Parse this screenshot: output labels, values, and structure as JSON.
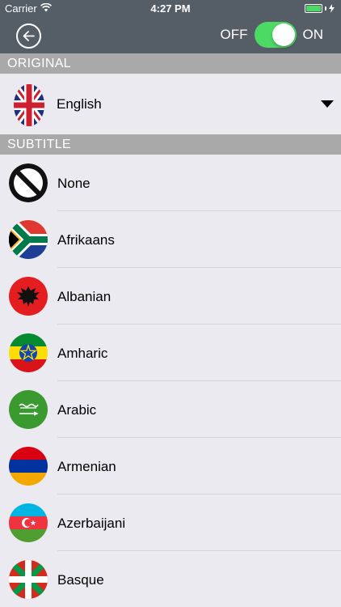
{
  "status_bar": {
    "carrier": "Carrier",
    "time": "4:27 PM"
  },
  "nav": {
    "toggle_off_label": "OFF",
    "toggle_on_label": "ON",
    "toggle_state": "on"
  },
  "sections": {
    "original": "ORIGINAL",
    "subtitle": "SUBTITLE"
  },
  "original": {
    "language": "English",
    "flag_icon": "uk-flag-icon"
  },
  "subtitle_languages": [
    {
      "label": "None",
      "icon": "none-icon"
    },
    {
      "label": "Afrikaans",
      "icon": "south-africa-flag-icon"
    },
    {
      "label": "Albanian",
      "icon": "albania-flag-icon"
    },
    {
      "label": "Amharic",
      "icon": "ethiopia-flag-icon"
    },
    {
      "label": "Arabic",
      "icon": "saudi-arabia-flag-icon"
    },
    {
      "label": "Armenian",
      "icon": "armenia-flag-icon"
    },
    {
      "label": "Azerbaijani",
      "icon": "azerbaijan-flag-icon"
    },
    {
      "label": "Basque",
      "icon": "basque-flag-icon"
    }
  ],
  "colors": {
    "nav_background": "#555e66",
    "toggle_on": "#4cd964",
    "section_header": "#a9a9a9",
    "list_background": "#ebeaf0"
  }
}
